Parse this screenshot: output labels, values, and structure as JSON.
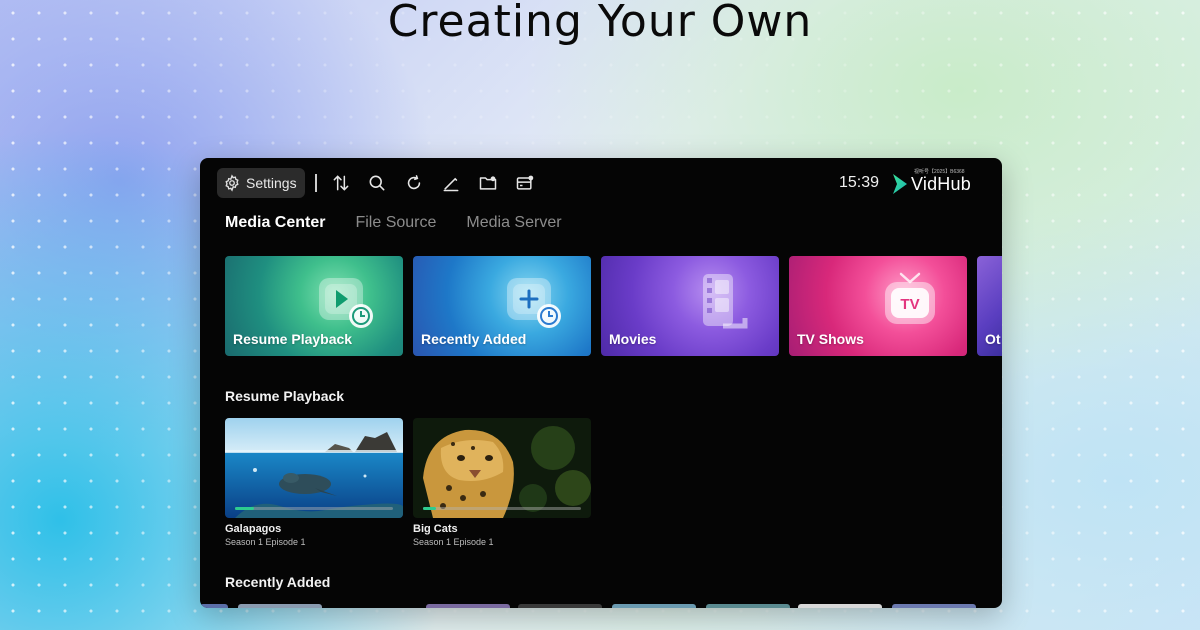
{
  "headline": "Creating Your Own",
  "app": {
    "brand_name": "VidHub",
    "brand_small": "视听号【2025】B6368",
    "clock": "15:39",
    "settings_label": "Settings",
    "toolbar_icons": [
      "sort-icon",
      "search-icon",
      "refresh-icon",
      "edit-icon",
      "folder-icon",
      "storage-icon"
    ]
  },
  "tabs": [
    {
      "label": "Media Center",
      "active": true
    },
    {
      "label": "File Source",
      "active": false
    },
    {
      "label": "Media Server",
      "active": false
    }
  ],
  "categories": [
    {
      "label": "Resume Playback",
      "icon": "play-clock-icon"
    },
    {
      "label": "Recently Added",
      "icon": "add-clock-icon"
    },
    {
      "label": "Movies",
      "icon": "film-reel-icon"
    },
    {
      "label": "TV Shows",
      "icon": "tv-icon"
    },
    {
      "label": "Ot"
    }
  ],
  "sections": {
    "resume_playback": "Resume Playback",
    "recently_added": "Recently Added"
  },
  "resume_items": [
    {
      "title": "Galapagos",
      "subtitle": "Season 1 Episode 1",
      "progress": 0.12
    },
    {
      "title": "Big Cats",
      "subtitle": "Season 1 Episode 1",
      "progress": 0.08
    }
  ],
  "colors": {
    "accent_green": "#2dcc8f",
    "window_bg": "#050505",
    "tab_inactive": "#8c8c8c"
  }
}
